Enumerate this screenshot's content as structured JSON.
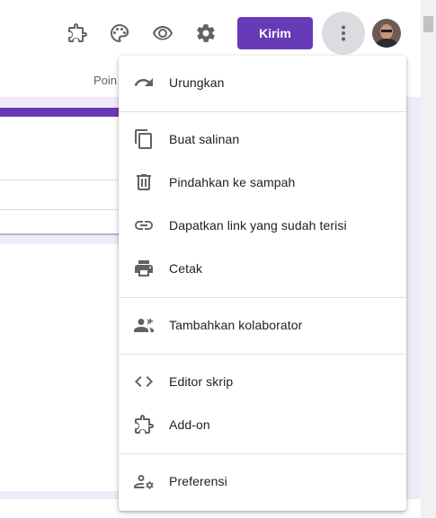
{
  "toolbar": {
    "send_label": "Kirim",
    "icons": [
      "addon-icon",
      "palette-icon",
      "preview-icon",
      "settings-icon",
      "more-vert-icon"
    ]
  },
  "tabs": {
    "points_partial": "Poin"
  },
  "menu": {
    "items": [
      {
        "label": "Urungkan",
        "icon": "undo-icon"
      },
      {
        "label": "Buat salinan",
        "icon": "copy-icon"
      },
      {
        "label": "Pindahkan ke sampah",
        "icon": "trash-icon"
      },
      {
        "label": "Dapatkan link yang sudah terisi",
        "icon": "link-icon"
      },
      {
        "label": "Cetak",
        "icon": "print-icon"
      },
      {
        "label": "Tambahkan kolaborator",
        "icon": "add-people-icon"
      },
      {
        "label": "Editor skrip",
        "icon": "code-icon"
      },
      {
        "label": "Add-on",
        "icon": "addon-icon"
      },
      {
        "label": "Preferensi",
        "icon": "preferences-icon"
      }
    ]
  },
  "colors": {
    "accent": "#673ab7",
    "background": "#f0ebf8"
  }
}
